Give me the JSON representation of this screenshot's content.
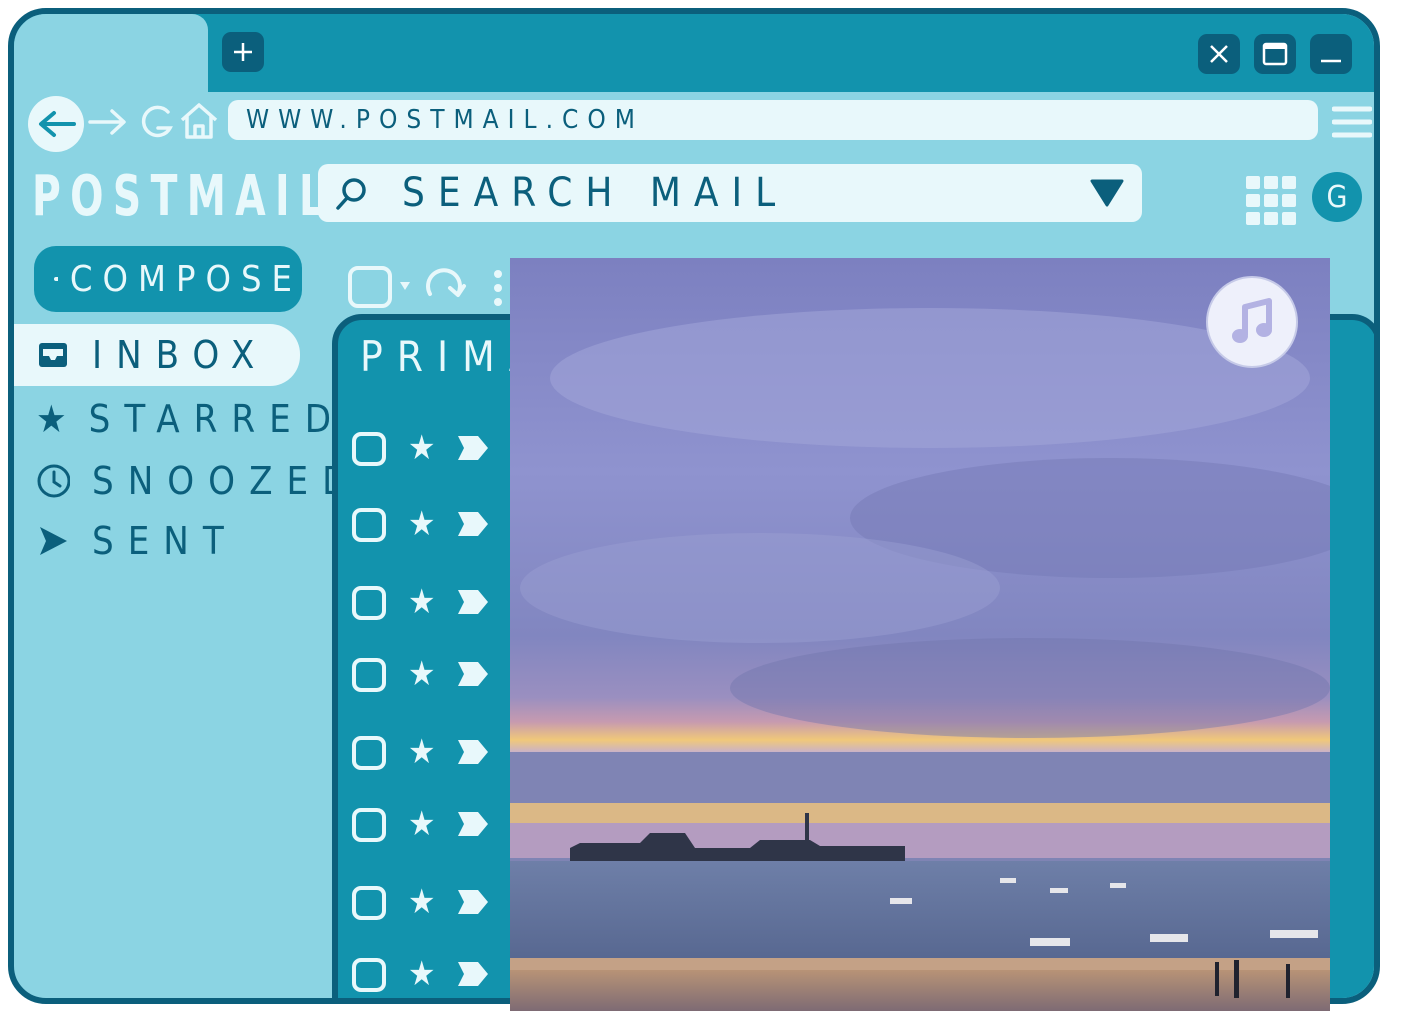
{
  "browser": {
    "url": "WWW.POSTMAIL.COM",
    "new_tab_icon": "plus-icon",
    "window_controls": [
      "close-icon",
      "maximize-icon",
      "minimize-icon"
    ]
  },
  "app": {
    "logo": "POSTMAIL",
    "search_placeholder": "SEARCH MAIL",
    "account_initial": "G",
    "compose_label": "COMPOSE"
  },
  "sidebar": {
    "items": [
      {
        "label": "INBOX",
        "icon": "inbox-icon",
        "active": true
      },
      {
        "label": "STARRED",
        "icon": "star-icon",
        "active": false
      },
      {
        "label": "SNOOZED",
        "icon": "clock-icon",
        "active": false
      },
      {
        "label": "SENT",
        "icon": "send-icon",
        "active": false
      }
    ]
  },
  "mail": {
    "tab_label": "PRIMAR",
    "row_count": 8
  },
  "overlay": {
    "photo": "sunset-beach-photo",
    "music_icon": "music-note-icon"
  },
  "colors": {
    "frame": "#0b5f7c",
    "accent": "#1293ad",
    "background": "#8bd4e3",
    "light": "#e8f8fb"
  }
}
